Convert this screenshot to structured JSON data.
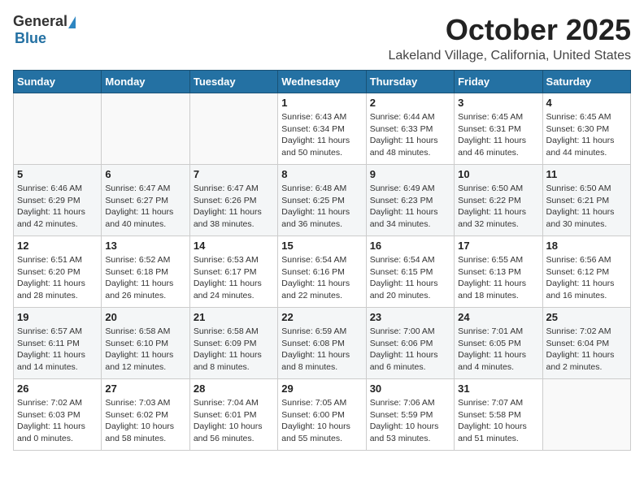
{
  "header": {
    "logo_general": "General",
    "logo_blue": "Blue",
    "month": "October 2025",
    "location": "Lakeland Village, California, United States"
  },
  "weekdays": [
    "Sunday",
    "Monday",
    "Tuesday",
    "Wednesday",
    "Thursday",
    "Friday",
    "Saturday"
  ],
  "weeks": [
    [
      {
        "day": "",
        "info": ""
      },
      {
        "day": "",
        "info": ""
      },
      {
        "day": "",
        "info": ""
      },
      {
        "day": "1",
        "info": "Sunrise: 6:43 AM\nSunset: 6:34 PM\nDaylight: 11 hours and 50 minutes."
      },
      {
        "day": "2",
        "info": "Sunrise: 6:44 AM\nSunset: 6:33 PM\nDaylight: 11 hours and 48 minutes."
      },
      {
        "day": "3",
        "info": "Sunrise: 6:45 AM\nSunset: 6:31 PM\nDaylight: 11 hours and 46 minutes."
      },
      {
        "day": "4",
        "info": "Sunrise: 6:45 AM\nSunset: 6:30 PM\nDaylight: 11 hours and 44 minutes."
      }
    ],
    [
      {
        "day": "5",
        "info": "Sunrise: 6:46 AM\nSunset: 6:29 PM\nDaylight: 11 hours and 42 minutes."
      },
      {
        "day": "6",
        "info": "Sunrise: 6:47 AM\nSunset: 6:27 PM\nDaylight: 11 hours and 40 minutes."
      },
      {
        "day": "7",
        "info": "Sunrise: 6:47 AM\nSunset: 6:26 PM\nDaylight: 11 hours and 38 minutes."
      },
      {
        "day": "8",
        "info": "Sunrise: 6:48 AM\nSunset: 6:25 PM\nDaylight: 11 hours and 36 minutes."
      },
      {
        "day": "9",
        "info": "Sunrise: 6:49 AM\nSunset: 6:23 PM\nDaylight: 11 hours and 34 minutes."
      },
      {
        "day": "10",
        "info": "Sunrise: 6:50 AM\nSunset: 6:22 PM\nDaylight: 11 hours and 32 minutes."
      },
      {
        "day": "11",
        "info": "Sunrise: 6:50 AM\nSunset: 6:21 PM\nDaylight: 11 hours and 30 minutes."
      }
    ],
    [
      {
        "day": "12",
        "info": "Sunrise: 6:51 AM\nSunset: 6:20 PM\nDaylight: 11 hours and 28 minutes."
      },
      {
        "day": "13",
        "info": "Sunrise: 6:52 AM\nSunset: 6:18 PM\nDaylight: 11 hours and 26 minutes."
      },
      {
        "day": "14",
        "info": "Sunrise: 6:53 AM\nSunset: 6:17 PM\nDaylight: 11 hours and 24 minutes."
      },
      {
        "day": "15",
        "info": "Sunrise: 6:54 AM\nSunset: 6:16 PM\nDaylight: 11 hours and 22 minutes."
      },
      {
        "day": "16",
        "info": "Sunrise: 6:54 AM\nSunset: 6:15 PM\nDaylight: 11 hours and 20 minutes."
      },
      {
        "day": "17",
        "info": "Sunrise: 6:55 AM\nSunset: 6:13 PM\nDaylight: 11 hours and 18 minutes."
      },
      {
        "day": "18",
        "info": "Sunrise: 6:56 AM\nSunset: 6:12 PM\nDaylight: 11 hours and 16 minutes."
      }
    ],
    [
      {
        "day": "19",
        "info": "Sunrise: 6:57 AM\nSunset: 6:11 PM\nDaylight: 11 hours and 14 minutes."
      },
      {
        "day": "20",
        "info": "Sunrise: 6:58 AM\nSunset: 6:10 PM\nDaylight: 11 hours and 12 minutes."
      },
      {
        "day": "21",
        "info": "Sunrise: 6:58 AM\nSunset: 6:09 PM\nDaylight: 11 hours and 8 minutes."
      },
      {
        "day": "22",
        "info": "Sunrise: 6:59 AM\nSunset: 6:08 PM\nDaylight: 11 hours and 8 minutes."
      },
      {
        "day": "23",
        "info": "Sunrise: 7:00 AM\nSunset: 6:06 PM\nDaylight: 11 hours and 6 minutes."
      },
      {
        "day": "24",
        "info": "Sunrise: 7:01 AM\nSunset: 6:05 PM\nDaylight: 11 hours and 4 minutes."
      },
      {
        "day": "25",
        "info": "Sunrise: 7:02 AM\nSunset: 6:04 PM\nDaylight: 11 hours and 2 minutes."
      }
    ],
    [
      {
        "day": "26",
        "info": "Sunrise: 7:02 AM\nSunset: 6:03 PM\nDaylight: 11 hours and 0 minutes."
      },
      {
        "day": "27",
        "info": "Sunrise: 7:03 AM\nSunset: 6:02 PM\nDaylight: 10 hours and 58 minutes."
      },
      {
        "day": "28",
        "info": "Sunrise: 7:04 AM\nSunset: 6:01 PM\nDaylight: 10 hours and 56 minutes."
      },
      {
        "day": "29",
        "info": "Sunrise: 7:05 AM\nSunset: 6:00 PM\nDaylight: 10 hours and 55 minutes."
      },
      {
        "day": "30",
        "info": "Sunrise: 7:06 AM\nSunset: 5:59 PM\nDaylight: 10 hours and 53 minutes."
      },
      {
        "day": "31",
        "info": "Sunrise: 7:07 AM\nSunset: 5:58 PM\nDaylight: 10 hours and 51 minutes."
      },
      {
        "day": "",
        "info": ""
      }
    ]
  ]
}
